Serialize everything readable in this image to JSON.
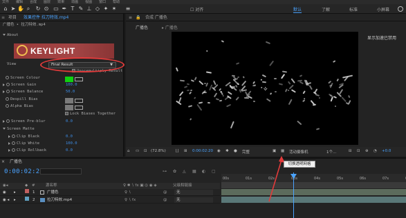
{
  "menu": [
    "文件",
    "编辑",
    "合成",
    "图层",
    "效果",
    "动画",
    "视图",
    "窗口",
    "帮助"
  ],
  "workspaces": [
    "默认",
    "了解",
    "标准",
    "小屏幕"
  ],
  "workspace_active": "默认",
  "effect_panel": {
    "tab_label": "效果控件 拉刀特效.mp4",
    "breadcrumb": "广播色 • 拉刀特效.mp4",
    "section": "About",
    "logo_text": "KEYLIGHT",
    "view_label": "View",
    "view_value": "Final Result",
    "unpremultiply_label": "Unpremultiply Result",
    "rows": [
      {
        "label": "Screen Colour",
        "value": ""
      },
      {
        "label": "Screen Gain",
        "value": "100.0"
      },
      {
        "label": "Screen Balance",
        "value": "50.0"
      },
      {
        "label": "Despill Bias",
        "value": ""
      },
      {
        "label": "Alpha Bias",
        "value": ""
      },
      {
        "label": "Lock Biases Together",
        "value": ""
      },
      {
        "label": "Screen Pre-blur",
        "value": "0.0"
      },
      {
        "label": "Screen Matte",
        "value": ""
      },
      {
        "label": "Clip Black",
        "value": "0.0"
      },
      {
        "label": "Clip White",
        "value": "100.0"
      },
      {
        "label": "Clip Rollback",
        "value": "0.0"
      }
    ],
    "screen_colour_hex": "#10d010"
  },
  "viewer": {
    "tab_label": "合成 广播色",
    "subtab": "广播色",
    "render_message": "显示加速已禁用",
    "zoom": "(72.8%)",
    "timecode": "0:00:02:20",
    "quality": "完整",
    "camera": "活动摄像机",
    "views": "1个...",
    "offset": "+0.0"
  },
  "tooltip": "切换透明网格",
  "timeline": {
    "tab_label": "广播色",
    "timecode": "0:00:02:20",
    "columns": {
      "name": "源名称",
      "parent": "父级和链接"
    },
    "layers": [
      {
        "index": "1",
        "name": "广播色",
        "parent": "无",
        "label_color": "#c06060"
      },
      {
        "index": "2",
        "name": "拉刀特效.mp4",
        "parent": "无",
        "label_color": "#60a0c0"
      }
    ],
    "ruler": [
      "00s",
      "01s",
      "02s",
      "03s",
      "04s",
      "05s",
      "06s",
      "07s",
      "08s"
    ]
  },
  "accent": "#4aa3ff",
  "annotation_color": "#e23b3b"
}
